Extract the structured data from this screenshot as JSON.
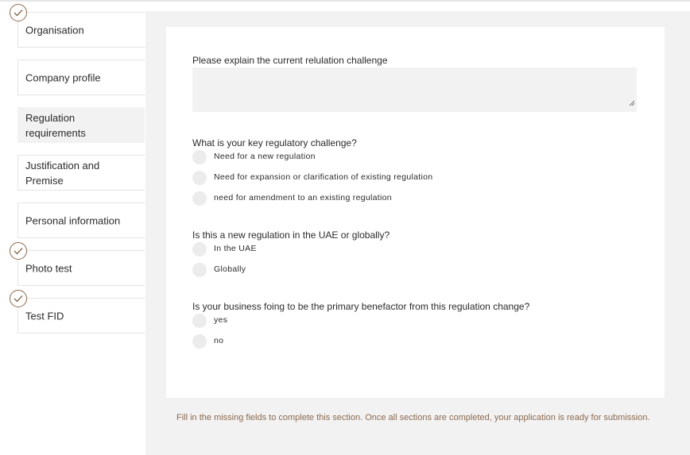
{
  "sidebar": {
    "items": [
      {
        "label": "Organisation",
        "completed": true,
        "active": false
      },
      {
        "label": "Company profile",
        "completed": false,
        "active": false
      },
      {
        "label": "Regulation requirements",
        "completed": false,
        "active": true
      },
      {
        "label": "Justification and Premise",
        "completed": false,
        "active": false
      },
      {
        "label": "Personal information",
        "completed": false,
        "active": false
      },
      {
        "label": "Photo test",
        "completed": true,
        "active": false
      },
      {
        "label": "Test FID",
        "completed": true,
        "active": false
      }
    ]
  },
  "form": {
    "q1": {
      "label": "Please explain the current relulation challenge",
      "value": ""
    },
    "q2": {
      "label": "What is your key regulatory challenge?",
      "options": [
        "Need for a new regulation",
        "Need for expansion or clarification of existing regulation",
        "need for amendment to an existing regulation"
      ]
    },
    "q3": {
      "label": "Is this a new regulation in the UAE or globally?",
      "options": [
        "In the UAE",
        "Globally"
      ]
    },
    "q4": {
      "label": "Is your business foing to be the primary benefactor from this regulation change?",
      "options": [
        "yes",
        "no"
      ]
    }
  },
  "footer": {
    "note": "Fill in the missing fields to complete this section. Once all sections are completed, your application is ready for submission."
  },
  "colors": {
    "accent": "#8b6a4f",
    "panel": "#f2f2f2",
    "radio": "#ececec"
  }
}
